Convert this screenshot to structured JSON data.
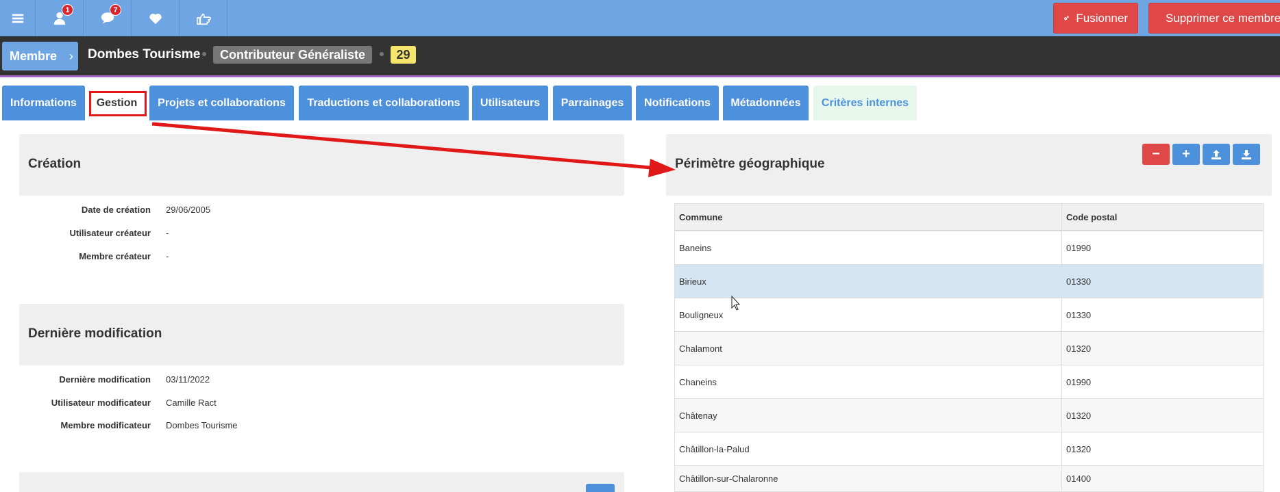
{
  "topbar": {
    "buttons": [
      {
        "icon": "menu-icon"
      },
      {
        "icon": "user-icon",
        "badge": "1"
      },
      {
        "icon": "chat-icon",
        "badge": "7"
      },
      {
        "icon": "heart-icon"
      },
      {
        "icon": "thumb-pointing-icon"
      }
    ],
    "merge_label": "Fusionner",
    "delete_label": "Supprimer ce membre"
  },
  "header": {
    "member_crumb": "Membre",
    "crumb_chevron": "›",
    "member_name": "Dombes Tourisme",
    "role": "Contributeur Généraliste",
    "count": "29"
  },
  "tabs": [
    {
      "label": "Informations"
    },
    {
      "label": "Gestion"
    },
    {
      "label": "Projets et collaborations"
    },
    {
      "label": "Traductions et collaborations"
    },
    {
      "label": "Utilisateurs"
    },
    {
      "label": "Parrainages"
    },
    {
      "label": "Notifications"
    },
    {
      "label": "Métadonnées"
    },
    {
      "label": "Critères internes"
    }
  ],
  "creation": {
    "title": "Création",
    "rows": [
      {
        "label": "Date de création",
        "value": "29/06/2005"
      },
      {
        "label": "Utilisateur créateur",
        "value": "-"
      },
      {
        "label": "Membre créateur",
        "value": "-"
      }
    ]
  },
  "modification": {
    "title": "Dernière modification",
    "rows": [
      {
        "label": "Dernière modification",
        "value": "03/11/2022"
      },
      {
        "label": "Utilisateur modificateur",
        "value": "Camille Ract"
      },
      {
        "label": "Membre modificateur",
        "value": "Dombes Tourisme"
      }
    ]
  },
  "perimetre": {
    "title": "Périmètre géographique",
    "actions": {
      "remove": "−",
      "add": "+"
    },
    "columns": [
      "Commune",
      "Code postal"
    ],
    "rows": [
      [
        "Baneins",
        "01990"
      ],
      [
        "Birieux",
        "01330"
      ],
      [
        "Bouligneux",
        "01330"
      ],
      [
        "Chalamont",
        "01320"
      ],
      [
        "Chaneins",
        "01990"
      ],
      [
        "Châtenay",
        "01320"
      ],
      [
        "Châtillon-la-Palud",
        "01320"
      ],
      [
        "Châtillon-sur-Chalaronne",
        "01400"
      ]
    ]
  },
  "colors": {
    "accent": "#4d90dc",
    "danger": "#e04747",
    "highlight": "#e01818"
  }
}
